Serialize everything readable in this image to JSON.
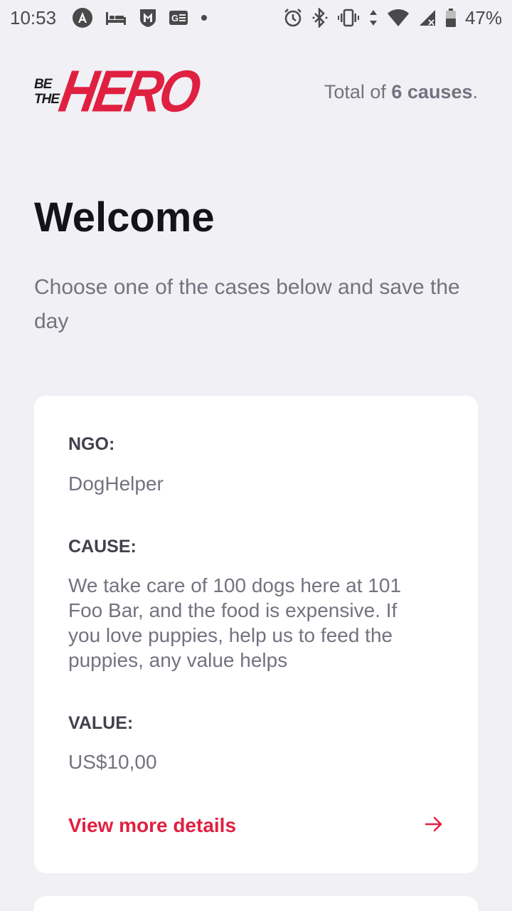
{
  "status_bar": {
    "time": "10:53",
    "battery": "47%",
    "left_icons": [
      "angular-icon",
      "bed-icon",
      "shield-m-icon",
      "news-icon",
      "dot-icon"
    ],
    "right_icons": [
      "alarm-icon",
      "bluetooth-icon",
      "vibrate-icon",
      "data-arrows-icon",
      "wifi-icon",
      "signal-icon",
      "battery-icon"
    ]
  },
  "header": {
    "logo_small_line1": "BE",
    "logo_small_line2": "THE",
    "logo_big": "HERO",
    "total_prefix": "Total of ",
    "total_count": "6 causes",
    "total_suffix": "."
  },
  "main": {
    "title": "Welcome",
    "description": "Choose one of the cases below and save the day"
  },
  "incident": {
    "ngo_label": "NGO:",
    "ngo_value": "DogHelper",
    "cause_label": "CAUSE:",
    "cause_value": "We take care of 100 dogs here at 101 Foo Bar, and the food is expensive. If you love puppies, help us to feed the puppies, any value helps",
    "value_label": "VALUE:",
    "value_value": "US$10,00",
    "details_label": "View more details"
  },
  "colors": {
    "background": "#f0f0f5",
    "accent": "#e02041",
    "title": "#13131a",
    "text_muted": "#737380",
    "label": "#41414d"
  }
}
